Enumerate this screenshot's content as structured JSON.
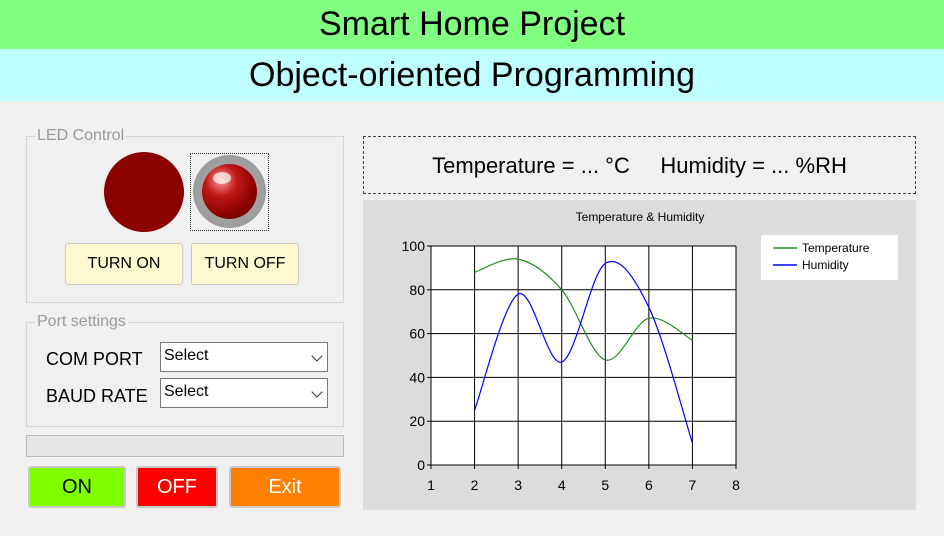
{
  "header": {
    "title": "Smart Home Project",
    "subtitle": "Object-oriented Programming"
  },
  "led_control": {
    "group_title": "LED Control",
    "led_color": "#8b0000",
    "turn_on_label": "TURN ON",
    "turn_off_label": "TURN OFF",
    "button_color": "#fff8d0"
  },
  "port_settings": {
    "group_title": "Port settings",
    "com_port_label": "COM PORT",
    "com_port_value": "Select",
    "baud_rate_label": "BAUD RATE",
    "baud_rate_value": "Select"
  },
  "progress": {
    "value": 0
  },
  "controls": {
    "on_label": "ON",
    "on_color": "#80ff00",
    "off_label": "OFF",
    "off_color": "#ff0000",
    "exit_label": "Exit",
    "exit_color": "#ff8000"
  },
  "readout": {
    "text": "Temperature = ... °C     Humidity = ... %RH"
  },
  "chart_data": {
    "type": "line",
    "title": "Temperature & Humidity",
    "xlim": [
      1,
      8
    ],
    "ylim": [
      0,
      100
    ],
    "x_ticks": [
      1,
      2,
      3,
      4,
      5,
      6,
      7,
      8
    ],
    "y_ticks": [
      0,
      20,
      40,
      60,
      80,
      100
    ],
    "grid": true,
    "legend_position": "top-right",
    "series": [
      {
        "name": "Temperature",
        "color": "#228b22",
        "x": [
          2,
          3,
          4,
          5,
          6,
          7
        ],
        "y": [
          88,
          94,
          80,
          48,
          67,
          57
        ]
      },
      {
        "name": "Humidity",
        "color": "#0000ff",
        "x": [
          2,
          3,
          4,
          5,
          6,
          7
        ],
        "y": [
          25,
          78,
          47,
          92,
          72,
          10
        ]
      }
    ]
  }
}
